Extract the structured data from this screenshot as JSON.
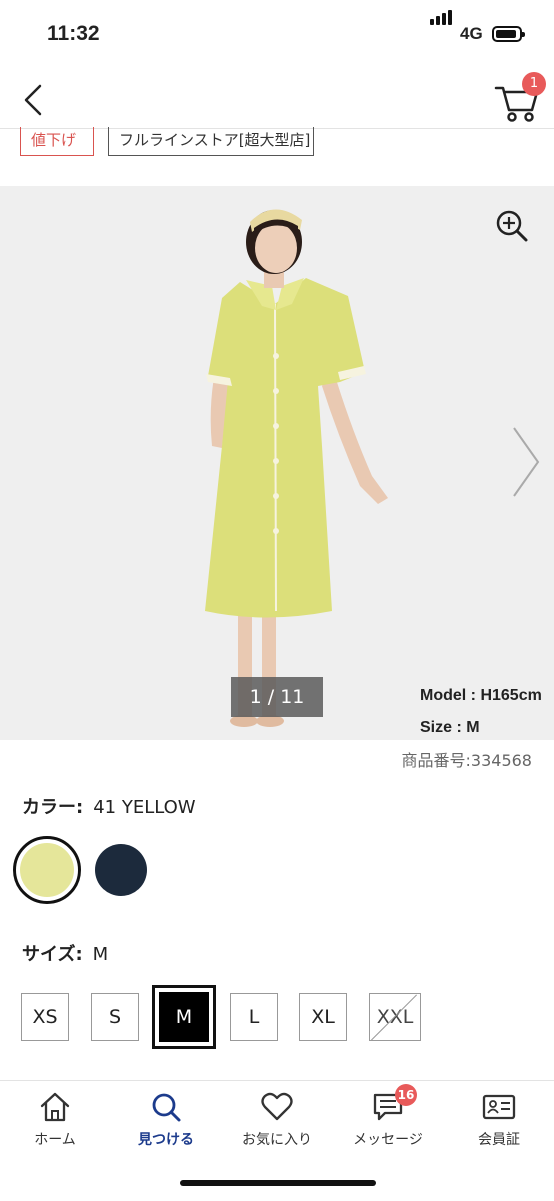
{
  "status_bar": {
    "time": "11:32",
    "network": "4G"
  },
  "cart": {
    "badge_count": "1"
  },
  "tags": {
    "sale": "値下げ",
    "store": "フルラインストア[超大型店]"
  },
  "image": {
    "counter": "1 / 11",
    "model_height": "Model : H165cm",
    "model_size": "Size : M"
  },
  "product": {
    "number": "商品番号:334568"
  },
  "color": {
    "label": "カラー:",
    "value": "41 YELLOW",
    "swatches": [
      {
        "name": "yellow",
        "hex": "#e5e69a",
        "selected": true
      },
      {
        "name": "navy",
        "hex": "#1c2a3c",
        "selected": false
      }
    ]
  },
  "size": {
    "label": "サイズ:",
    "value": "M",
    "options": [
      "XS",
      "S",
      "M",
      "L",
      "XL",
      "XXL"
    ]
  },
  "bottom_nav": {
    "home": "ホーム",
    "find": "見つける",
    "favorites": "お気に入り",
    "messages": "メッセージ",
    "message_badge": "16",
    "member": "会員証"
  },
  "colors": {
    "accent": "#1c3b8c",
    "badge": "#e85a5a",
    "sale": "#d9534f"
  }
}
